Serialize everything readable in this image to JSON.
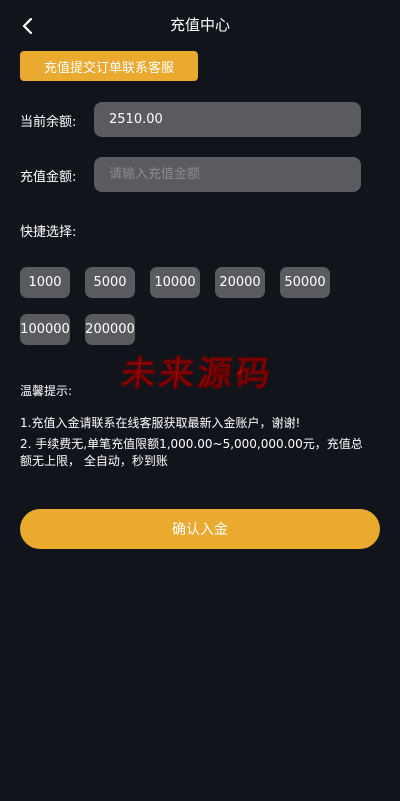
{
  "header": {
    "title": "充值中心",
    "back_icon": "chevron-left-icon"
  },
  "contact_button": {
    "label": "充值提交订单联系客服"
  },
  "balance": {
    "label": "当前余额:",
    "value": "2510.00"
  },
  "amount": {
    "label": "充值金额:",
    "value": "",
    "placeholder": "请输入充值金额"
  },
  "quick_select": {
    "label": "快捷选择:",
    "options": [
      "1000",
      "5000",
      "10000",
      "20000",
      "50000",
      "100000",
      "200000"
    ]
  },
  "watermark": {
    "text": "未来源码"
  },
  "tips": {
    "title": "温馨提示:",
    "lines": [
      "1.充值入金请联系在线客服获取最新入金账户，谢谢!",
      "2. 手续费无,单笔充值限额1,000.00~5,000,000.00元，充值总额无上限， 全自动，秒到账"
    ]
  },
  "confirm_button": {
    "label": "确认入金"
  },
  "colors": {
    "background": "#12141c",
    "accent": "#eaa92f",
    "field": "#5a5b5e",
    "watermark": "#c01818"
  }
}
